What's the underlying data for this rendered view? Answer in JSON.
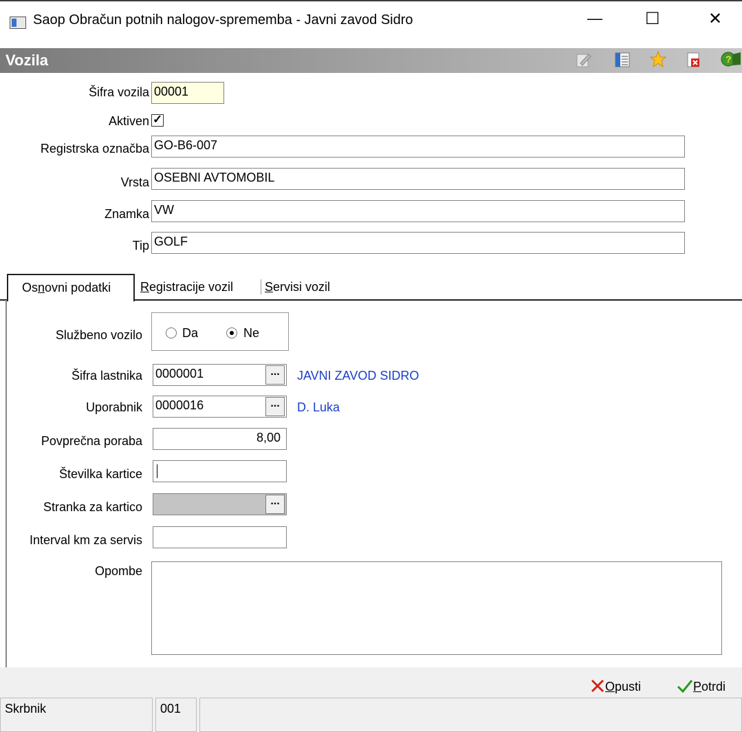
{
  "window": {
    "title": "Saop Obračun potnih nalogov-sprememba - Javni zavod Sidro",
    "minimize": "—",
    "maximize": "☐",
    "close": "✕"
  },
  "header": {
    "title": "Vozila",
    "icons": [
      "edit-icon",
      "list-icon",
      "favorite-star-icon",
      "delete-icon",
      "help-icon"
    ]
  },
  "top": {
    "sifra_vozila": {
      "label": "Šifra vozila",
      "value": "00001"
    },
    "aktiven": {
      "label": "Aktiven",
      "checked": true,
      "mark": "✓"
    },
    "registrska_oznacba": {
      "label": "Registrska označba",
      "value": "GO-B6-007"
    },
    "vrsta": {
      "label": "Vrsta",
      "value": "OSEBNI AVTOMOBIL"
    },
    "znamka": {
      "label": "Znamka",
      "value": "VW"
    },
    "tip": {
      "label": "Tip",
      "value": "GOLF"
    }
  },
  "tabs": [
    {
      "pre": "Os",
      "key": "n",
      "post": "ovni podatki",
      "active": true
    },
    {
      "pre": "",
      "key": "R",
      "post": "egistracije vozil",
      "active": false
    },
    {
      "pre": "",
      "key": "S",
      "post": "ervisi vozil",
      "active": false
    }
  ],
  "form": {
    "sluzbeno_vozilo": {
      "label": "Službeno vozilo",
      "options": [
        "Da",
        "Ne"
      ],
      "selected": "Ne"
    },
    "sifra_lastnika": {
      "label": "Šifra lastnika",
      "value": "0000001",
      "desc": "JAVNI ZAVOD SIDRO"
    },
    "uporabnik": {
      "label": "Uporabnik",
      "value": "0000016",
      "desc": "D. Luka"
    },
    "povprecna_poraba": {
      "label": "Povprečna poraba",
      "value": "8,00"
    },
    "stevilka_kartice": {
      "label": "Številka kartice",
      "value": ""
    },
    "stranka_za_kartico": {
      "label": "Stranka za kartico",
      "value": ""
    },
    "interval_km": {
      "label": "Interval km za servis",
      "value": ""
    },
    "opombe": {
      "label": "Opombe",
      "value": ""
    },
    "lookup_button": "..."
  },
  "buttons": {
    "opusti": {
      "key": "O",
      "rest": "pusti"
    },
    "potrdi": {
      "key": "P",
      "rest": "otrdi"
    }
  },
  "status": {
    "label": "Skrbnik",
    "value": "001"
  },
  "colors": {
    "header_gradient_start": "#7a7a7a",
    "header_gradient_end": "#c8c8c8",
    "required_field": "#ffffe1",
    "link_blue": "#1a3ec9",
    "disabled_field": "#c4c4c4"
  }
}
